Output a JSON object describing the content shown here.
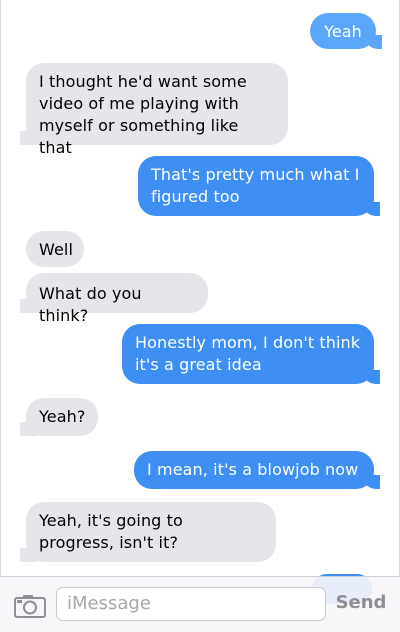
{
  "conversation": {
    "messages": [
      {
        "text": "Yeah",
        "side": "out"
      },
      {
        "text": "I thought he'd want some video of me playing with myself or something like that",
        "side": "in"
      },
      {
        "text": "That's pretty much what I figured too",
        "side": "out"
      },
      {
        "text": "Well",
        "side": "in"
      },
      {
        "text": "What do you think?",
        "side": "in"
      },
      {
        "text": "Honestly mom, I don't think it's a great idea",
        "side": "out"
      },
      {
        "text": "Yeah?",
        "side": "in"
      },
      {
        "text": "I mean, it's a blowjob now",
        "side": "out"
      },
      {
        "text": "Yeah, it's going to progress, isn't it?",
        "side": "in"
      },
      {
        "text": "",
        "side": "out"
      }
    ]
  },
  "composer": {
    "camera_icon": "camera-icon",
    "placeholder": "iMessage",
    "send_label": "Send"
  },
  "colors": {
    "outgoing": "#3e8ef4",
    "incoming": "#e5e5ea",
    "send_disabled": "#8e8e93"
  }
}
